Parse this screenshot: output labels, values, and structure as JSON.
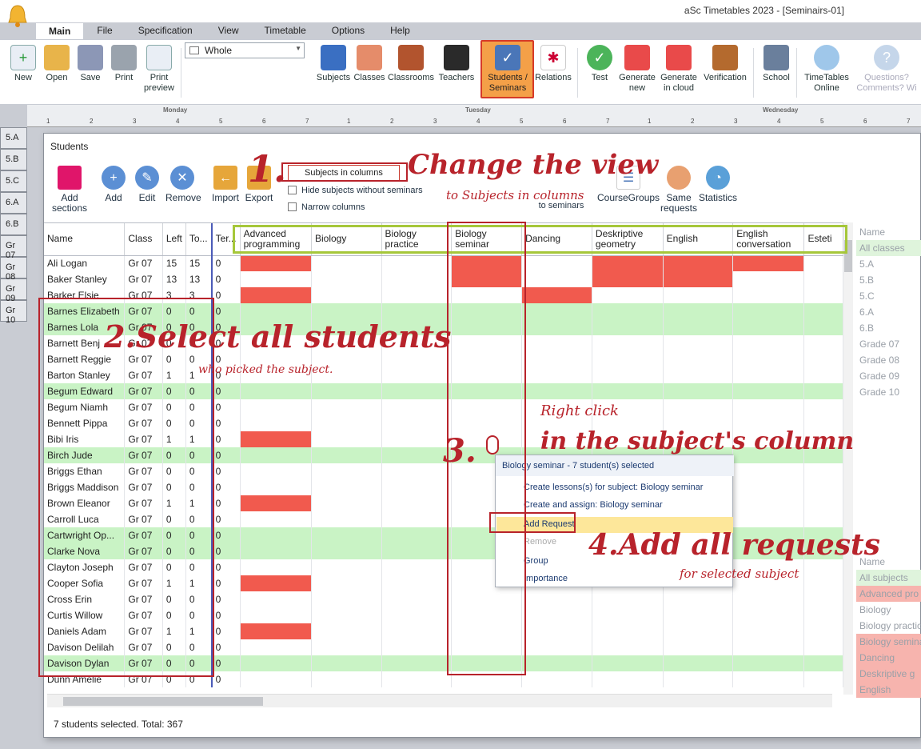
{
  "window": {
    "title": "aSc Timetables 2023  - [Seminairs-01]"
  },
  "ribbon": {
    "tabs": [
      "Main",
      "File",
      "Specification",
      "View",
      "Timetable",
      "Options",
      "Help"
    ],
    "buttons": {
      "new": "New",
      "open": "Open",
      "save": "Save",
      "print": "Print",
      "print_preview": "Print preview",
      "subjects": "Subjects",
      "classes": "Classes",
      "classrooms": "Classrooms",
      "teachers": "Teachers",
      "students_seminars": "Students / Seminars",
      "relations": "Relations",
      "test": "Test",
      "generate_new": "Generate new",
      "generate_cloud": "Generate in cloud",
      "verification": "Verification",
      "school": "School",
      "timetables_online": "TimeTables Online",
      "questions": "Questions? Comments? Wi"
    },
    "view_select": "Whole"
  },
  "timetable_bg": {
    "days": [
      "Monday",
      "Tuesday",
      "Wednesday"
    ],
    "periods": [
      "1",
      "2",
      "3",
      "4",
      "5",
      "6",
      "7"
    ],
    "rows": [
      "5.A",
      "5.B",
      "5.C",
      "6.A",
      "6.B",
      "Gr 07",
      "Gr 08",
      "Gr 09",
      "Gr 10"
    ]
  },
  "dialog": {
    "title": "Students",
    "toolbar": {
      "add_sections": "Add sections",
      "add": "Add",
      "edit": "Edit",
      "remove": "Remove",
      "import": "Import",
      "export": "Export",
      "view_select": "Subjects in columns",
      "hide_subjects": "Hide subjects without seminars",
      "narrow_columns": "Narrow columns",
      "course_groups": "CourseGroups",
      "same_requests": "Same requests",
      "statistics": "Statistics",
      "partial_seminars": "to seminars"
    },
    "columns": [
      "Name",
      "Class",
      "Left",
      "To...",
      "Ter...",
      "Advanced programming",
      "Biology",
      "Biology practice",
      "Biology seminar",
      "Dancing",
      "Deskriptive geometry",
      "English",
      "English conversation",
      "Esteti"
    ],
    "rows": [
      {
        "name": "Ali  Logan",
        "class": "Gr 07",
        "left": "15",
        "total": "15",
        "ter": "0",
        "sel": false,
        "red": [
          0,
          3,
          5,
          6,
          7
        ]
      },
      {
        "name": "Baker  Stanley",
        "class": "Gr 07",
        "left": "13",
        "total": "13",
        "ter": "0",
        "sel": false,
        "red": [
          3,
          5,
          6
        ]
      },
      {
        "name": "Barker  Elsie",
        "class": "Gr 07",
        "left": "3",
        "total": "3",
        "ter": "0",
        "sel": false,
        "red": [
          0,
          4
        ]
      },
      {
        "name": "Barnes  Elizabeth",
        "class": "Gr 07",
        "left": "0",
        "total": "0",
        "ter": "0",
        "sel": true,
        "red": []
      },
      {
        "name": "Barnes  Lola",
        "class": "Gr 07",
        "left": "0",
        "total": "0",
        "ter": "0",
        "sel": true,
        "red": []
      },
      {
        "name": "Barnett  Benj",
        "class": "Gr 07",
        "left": "0",
        "total": "0",
        "ter": "0",
        "sel": false,
        "red": []
      },
      {
        "name": "Barnett  Reggie",
        "class": "Gr 07",
        "left": "0",
        "total": "0",
        "ter": "0",
        "sel": false,
        "red": []
      },
      {
        "name": "Barton  Stanley",
        "class": "Gr 07",
        "left": "1",
        "total": "1",
        "ter": "0",
        "sel": false,
        "red": []
      },
      {
        "name": "Begum  Edward",
        "class": "Gr 07",
        "left": "0",
        "total": "0",
        "ter": "0",
        "sel": true,
        "red": []
      },
      {
        "name": "Begum  Niamh",
        "class": "Gr 07",
        "left": "0",
        "total": "0",
        "ter": "0",
        "sel": false,
        "red": []
      },
      {
        "name": "Bennett  Pippa",
        "class": "Gr 07",
        "left": "0",
        "total": "0",
        "ter": "0",
        "sel": false,
        "red": []
      },
      {
        "name": "Bibi  Iris",
        "class": "Gr 07",
        "left": "1",
        "total": "1",
        "ter": "0",
        "sel": false,
        "red": [
          0
        ]
      },
      {
        "name": "Birch  Jude",
        "class": "Gr 07",
        "left": "0",
        "total": "0",
        "ter": "0",
        "sel": true,
        "red": []
      },
      {
        "name": "Briggs  Ethan",
        "class": "Gr 07",
        "left": "0",
        "total": "0",
        "ter": "0",
        "sel": false,
        "red": []
      },
      {
        "name": "Briggs  Maddison",
        "class": "Gr 07",
        "left": "0",
        "total": "0",
        "ter": "0",
        "sel": false,
        "red": []
      },
      {
        "name": "Brown  Eleanor",
        "class": "Gr 07",
        "left": "1",
        "total": "1",
        "ter": "0",
        "sel": false,
        "red": [
          0
        ]
      },
      {
        "name": "Carroll  Luca",
        "class": "Gr 07",
        "left": "0",
        "total": "0",
        "ter": "0",
        "sel": false,
        "red": []
      },
      {
        "name": "Cartwright  Op...",
        "class": "Gr 07",
        "left": "0",
        "total": "0",
        "ter": "0",
        "sel": true,
        "red": []
      },
      {
        "name": "Clarke  Nova",
        "class": "Gr 07",
        "left": "0",
        "total": "0",
        "ter": "0",
        "sel": true,
        "red": []
      },
      {
        "name": "Clayton  Joseph",
        "class": "Gr 07",
        "left": "0",
        "total": "0",
        "ter": "0",
        "sel": false,
        "red": []
      },
      {
        "name": "Cooper  Sofia",
        "class": "Gr 07",
        "left": "1",
        "total": "1",
        "ter": "0",
        "sel": false,
        "red": [
          0
        ]
      },
      {
        "name": "Cross  Erin",
        "class": "Gr 07",
        "left": "0",
        "total": "0",
        "ter": "0",
        "sel": false,
        "red": []
      },
      {
        "name": "Curtis  Willow",
        "class": "Gr 07",
        "left": "0",
        "total": "0",
        "ter": "0",
        "sel": false,
        "red": []
      },
      {
        "name": "Daniels  Adam",
        "class": "Gr 07",
        "left": "1",
        "total": "1",
        "ter": "0",
        "sel": false,
        "red": [
          0
        ]
      },
      {
        "name": "Davison  Delilah",
        "class": "Gr 07",
        "left": "0",
        "total": "0",
        "ter": "0",
        "sel": false,
        "red": []
      },
      {
        "name": "Davison  Dylan",
        "class": "Gr 07",
        "left": "0",
        "total": "0",
        "ter": "0",
        "sel": true,
        "red": []
      },
      {
        "name": "Dunn  Amelie",
        "class": "Gr 07",
        "left": "0",
        "total": "0",
        "ter": "0",
        "sel": false,
        "red": []
      }
    ],
    "status": "7 students selected. Total: 367"
  },
  "right_panel_classes": {
    "header": "Name",
    "items": [
      "All classes",
      "5.A",
      "5.B",
      "5.C",
      "6.A",
      "6.B",
      "Grade 07",
      "Grade 08",
      "Grade 09",
      "Grade 10"
    ]
  },
  "right_panel_subjects": {
    "header": "Name",
    "items": [
      "All subjects",
      "Advanced pro",
      "Biology",
      "Biology practic",
      "Biology semina",
      "Dancing",
      "Deskriptive g",
      "English"
    ]
  },
  "context_menu": {
    "title": "Biology seminar - 7 student(s) selected",
    "items": [
      "Create lessons(s) for subject: Biology seminar",
      "Create and assign:  Biology seminar",
      "Add Request",
      "Remove",
      "Group",
      "Importance"
    ]
  },
  "annotations": {
    "step1": "1.",
    "step1_text": "Change the view",
    "step1_sub": "to Subjects in columns",
    "step2": "2.Select all students",
    "step2_sub": "who picked the subject.",
    "step3": "3.",
    "step3_a": "Right click",
    "step3_b": "in the subject's column",
    "step4": "4.Add all requests",
    "step4_sub": "for selected subject"
  },
  "colors": {
    "selected_row": "#c9f3c5",
    "request_cell": "#f15a4e",
    "annotation": "#b8232b",
    "header_highlight": "#a6c73a",
    "ribbon_active": "#f4a048"
  }
}
